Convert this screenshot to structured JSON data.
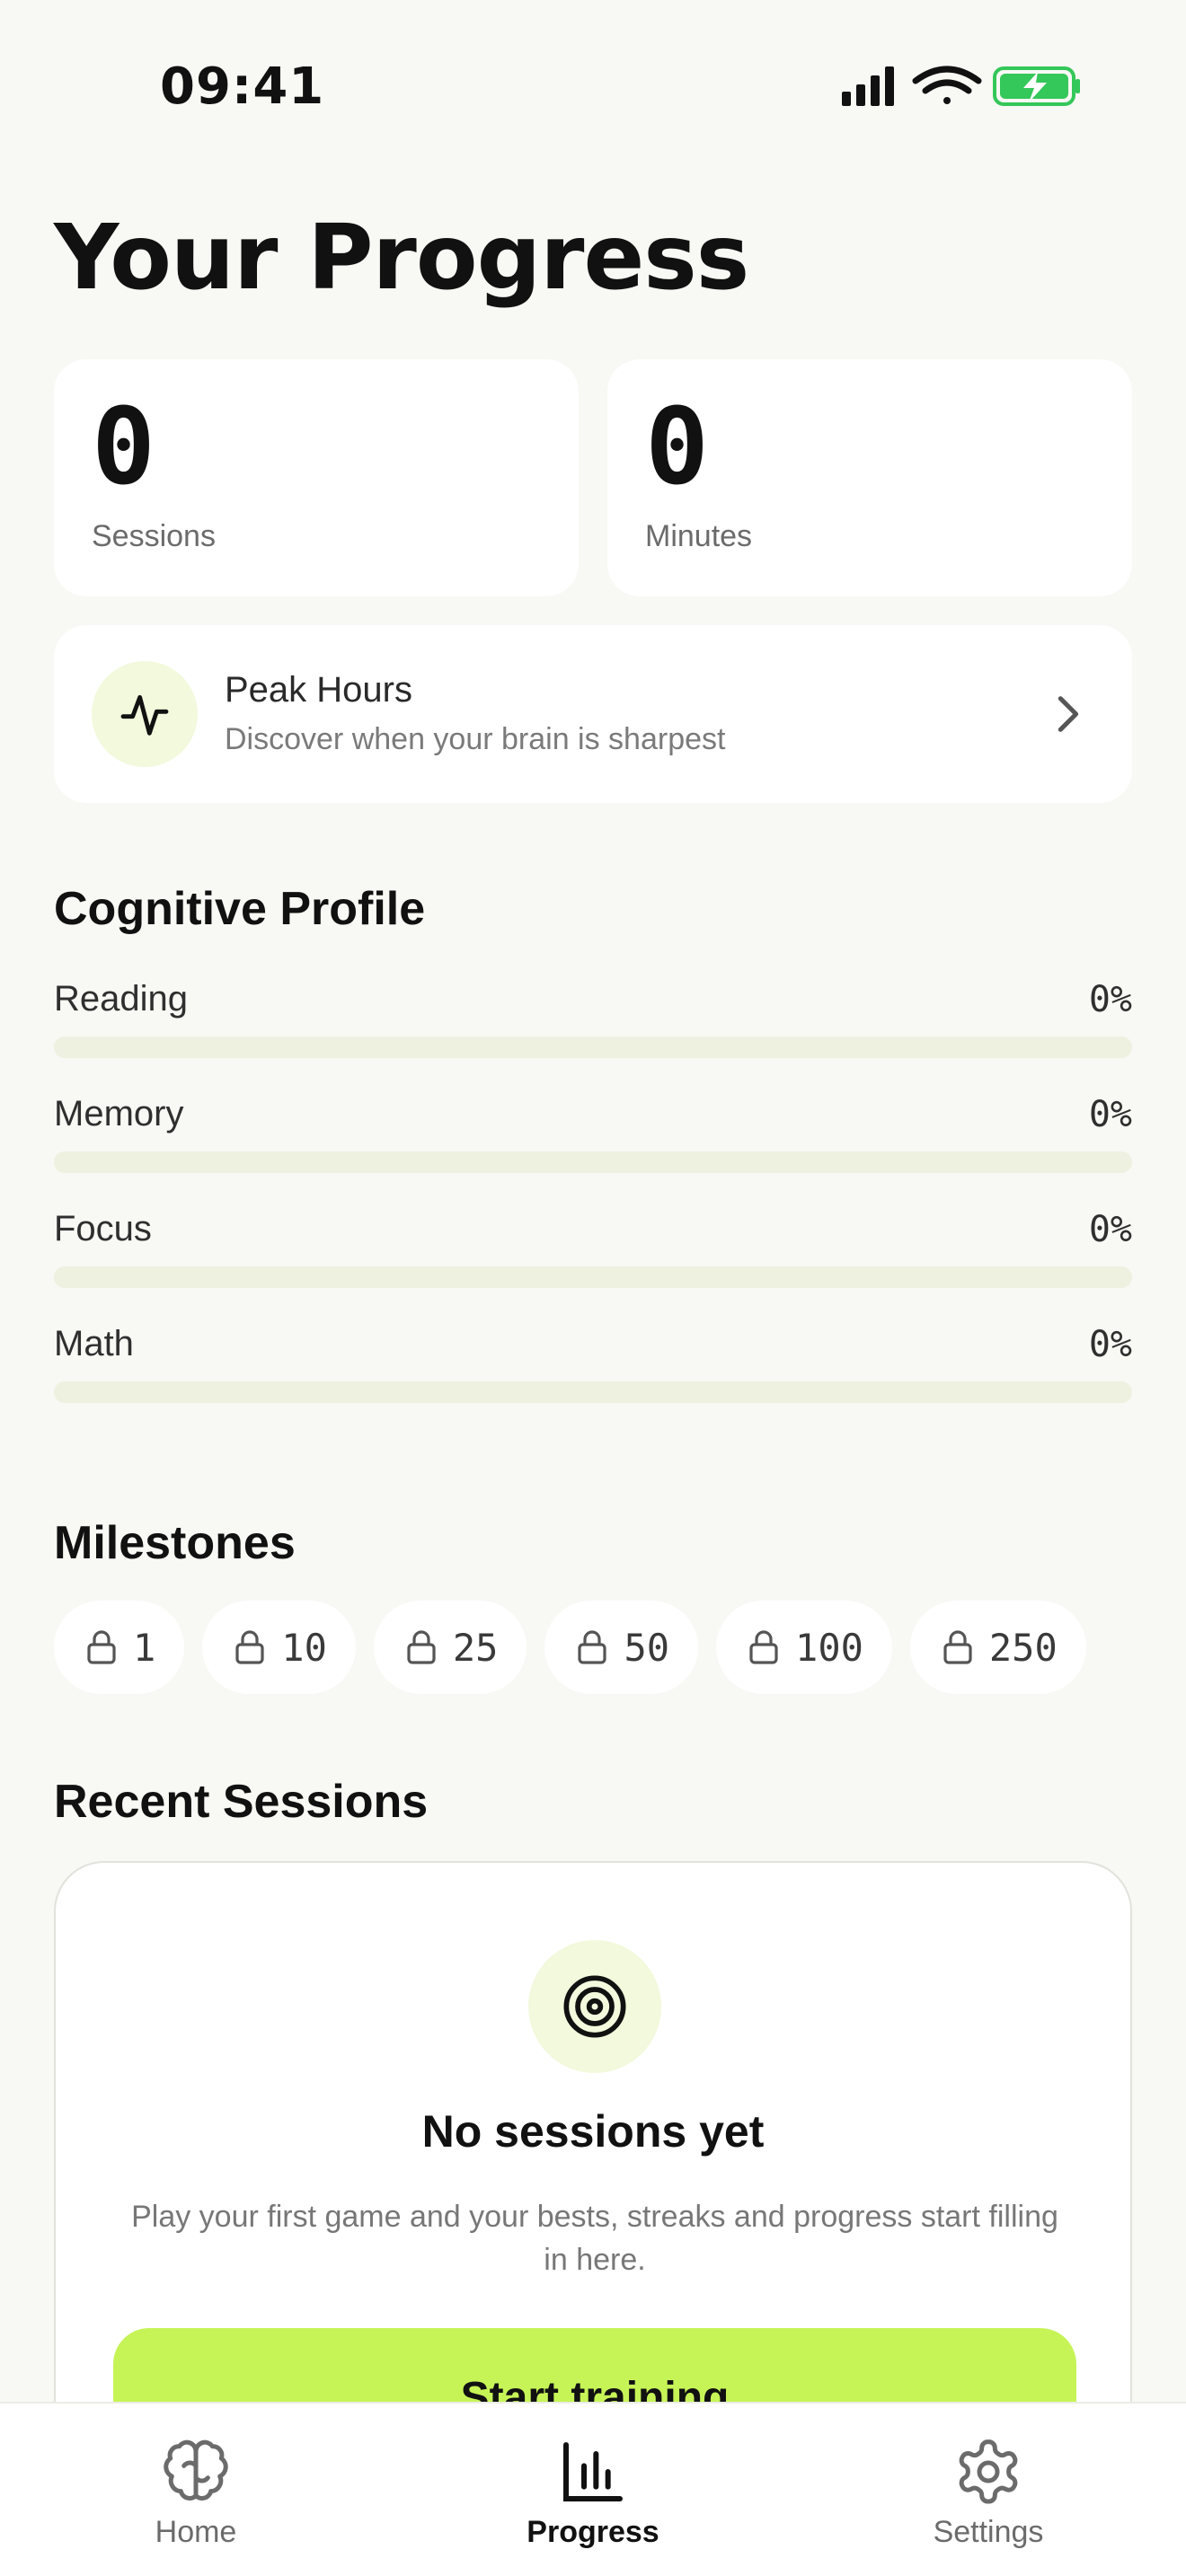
{
  "status_bar": {
    "time": "09:41"
  },
  "title": "Your Progress",
  "stats": [
    {
      "value": "0",
      "label": "Sessions"
    },
    {
      "value": "0",
      "label": "Minutes"
    }
  ],
  "peak_hours": {
    "title": "Peak Hours",
    "subtitle": "Discover when your brain is sharpest",
    "icon": "activity-icon"
  },
  "cognitive_profile": {
    "title": "Cognitive Profile",
    "metrics": [
      {
        "label": "Reading",
        "value": "0%",
        "progress": 0
      },
      {
        "label": "Memory",
        "value": "0%",
        "progress": 0
      },
      {
        "label": "Focus",
        "value": "0%",
        "progress": 0
      },
      {
        "label": "Math",
        "value": "0%",
        "progress": 0
      }
    ]
  },
  "milestones": {
    "title": "Milestones",
    "items": [
      "1",
      "10",
      "25",
      "50",
      "100",
      "250"
    ],
    "icon": "lock-icon"
  },
  "recent_sessions": {
    "title": "Recent Sessions",
    "empty_title": "No sessions yet",
    "empty_text": "Play your first game and your bests, streaks and progress start filling in here.",
    "button_label": "Start training",
    "icon": "target-icon"
  },
  "tabs": [
    {
      "label": "Home",
      "icon": "brain-icon",
      "active": false
    },
    {
      "label": "Progress",
      "icon": "bar-chart-icon",
      "active": true
    },
    {
      "label": "Settings",
      "icon": "gear-icon",
      "active": false
    }
  ],
  "colors": {
    "background": "#F8F8F4",
    "accent": "#C6F457",
    "accent_soft": "#F2F9DC",
    "battery": "#34C759"
  }
}
